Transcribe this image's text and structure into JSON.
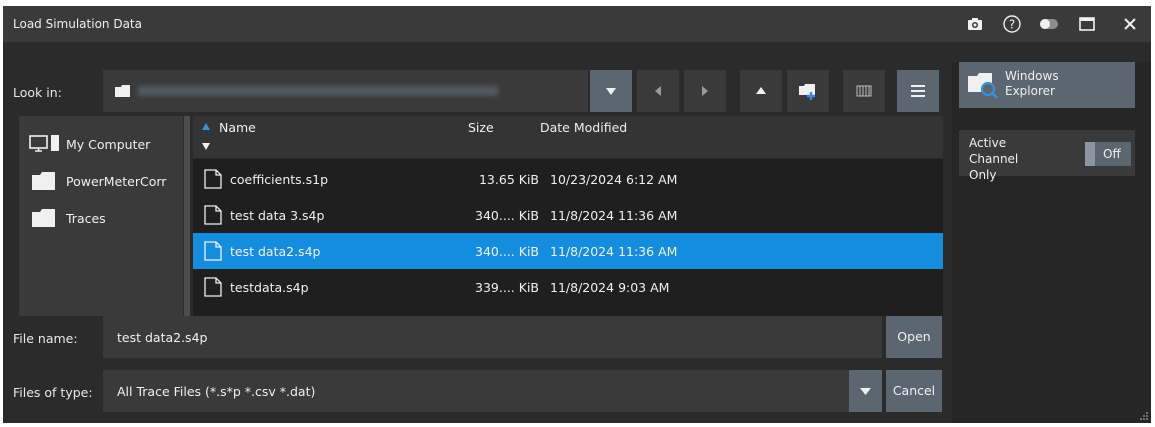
{
  "window": {
    "title": "Load Simulation Data",
    "controls": [
      "camera-icon",
      "help-icon",
      "toggle-icon",
      "maximize-icon",
      "close-icon"
    ]
  },
  "look_in": {
    "label": "Look in:",
    "path": ""
  },
  "toolbar": {
    "buttons": [
      "dropdown-icon",
      "back-icon",
      "forward-icon",
      "up-icon",
      "new-folder-icon",
      "detail-view-icon",
      "list-view-icon"
    ]
  },
  "sidebar": {
    "items": [
      {
        "label": "My Computer",
        "icon": "computer-icon"
      },
      {
        "label": "PowerMeterCorr",
        "icon": "folder-icon"
      },
      {
        "label": "Traces",
        "icon": "folder-icon"
      }
    ]
  },
  "file_list": {
    "columns": {
      "name": "Name",
      "size": "Size",
      "date": "Date Modified"
    },
    "rows": [
      {
        "name": "coefficients.s1p",
        "size": "13.65 KiB",
        "date": "10/23/2024 6:12 AM",
        "selected": false
      },
      {
        "name": "test data 3.s4p",
        "size": "340.... KiB",
        "date": "11/8/2024 11:36 AM",
        "selected": false
      },
      {
        "name": "test data2.s4p",
        "size": "340.... KiB",
        "date": "11/8/2024 11:36 AM",
        "selected": true
      },
      {
        "name": "testdata.s4p",
        "size": "339.... KiB",
        "date": "11/8/2024 9:03 AM",
        "selected": false
      }
    ]
  },
  "file_name": {
    "label": "File name:",
    "value": "test data2.s4p"
  },
  "file_type": {
    "label": "Files of type:",
    "value": "All Trace Files (*.s*p *.csv *.dat)"
  },
  "buttons": {
    "open": "Open",
    "cancel": "Cancel"
  },
  "right_panel": {
    "windows_explorer": "Windows\nExplorer",
    "windows_explorer_line1": "Windows",
    "windows_explorer_line2": "Explorer",
    "active_channel_label": "Active Channel Only",
    "active_channel_line1": "Active Channel",
    "active_channel_line2": "Only",
    "active_channel_state": "Off"
  },
  "colors": {
    "background": "#2b2b2b",
    "selection": "#148dde",
    "button": "#5c6670",
    "accent_blue": "#3a8fd8"
  }
}
